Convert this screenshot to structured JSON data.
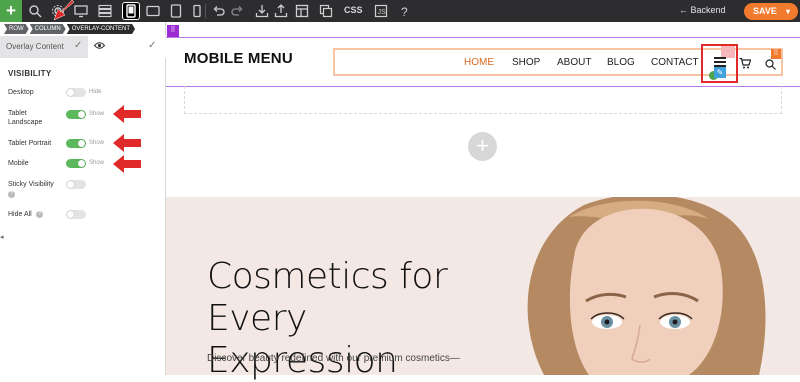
{
  "toolbar": {
    "add_label": "+",
    "css_label": "CSS",
    "backend_label": "← Backend",
    "save_label": "SAVE",
    "save_caret": "▾",
    "icons": [
      "search-icon",
      "settings-icon",
      "desktop-icon",
      "layers-icon",
      "mobile-icon",
      "tablet-icon",
      "tablet-portrait-icon",
      "mobile-small-icon",
      "undo-icon",
      "redo-icon",
      "download-icon",
      "upload-icon",
      "template-icon",
      "clone-icon",
      "css-icon",
      "code-icon",
      "help-icon"
    ]
  },
  "panel": {
    "breadcrumb": [
      "ROW",
      "COLUMN",
      "OVERLAY-CONTENT"
    ],
    "tab_label": "Overlay Content",
    "tab_check": "✓",
    "eye_glyph": "👁",
    "section_title": "VISIBILITY",
    "rows": [
      {
        "label": "Desktop",
        "state": "Hide",
        "on": false
      },
      {
        "label": "Tablet Landscape",
        "state": "Show",
        "on": true
      },
      {
        "label": "Tablet Portrait",
        "state": "Show",
        "on": true
      },
      {
        "label": "Mobile",
        "state": "Show",
        "on": true
      },
      {
        "label": "Sticky Visibility",
        "state": "",
        "on": false,
        "help": "?"
      },
      {
        "label": "Hide All",
        "state": "",
        "on": false,
        "help": "?"
      }
    ],
    "collapse_glyph": "◂"
  },
  "header": {
    "brand": "MOBILE MENU",
    "nav": [
      "HOME",
      "SHOP",
      "ABOUT",
      "BLOG",
      "CONTACT"
    ],
    "purple_tag": "⠿",
    "orange_tag": "⠿",
    "hamb_edit": "✎"
  },
  "canvas": {
    "plus": "+"
  },
  "hero": {
    "title_line1": "Cosmetics for",
    "title_line2": "Every Expression",
    "subtitle": "Discover beauty redefined with our premium cosmetics—"
  },
  "colors": {
    "accent_orange": "#f27a2d",
    "toggle_on": "#5cb85c",
    "annotation_red": "#e02a2a",
    "nav_active": "#d6691f",
    "hero_bg": "#f3e8e4"
  }
}
